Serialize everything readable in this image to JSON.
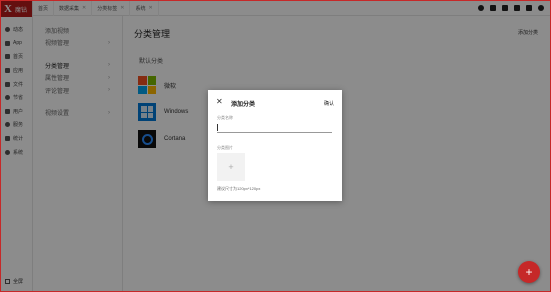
{
  "app": {
    "logo_letter": "X",
    "logo_text": "魔钻"
  },
  "sidebar": {
    "items": [
      {
        "label": "动态",
        "icon": "activity-icon"
      },
      {
        "label": "App",
        "icon": "phone-icon"
      },
      {
        "label": "首页",
        "icon": "folder-icon"
      },
      {
        "label": "应用",
        "icon": "apps-icon"
      },
      {
        "label": "文件",
        "icon": "file-icon"
      },
      {
        "label": "节省",
        "icon": "save-icon"
      },
      {
        "label": "用户",
        "icon": "user-icon"
      },
      {
        "label": "服务",
        "icon": "heart-icon"
      },
      {
        "label": "统计",
        "icon": "chart-icon"
      },
      {
        "label": "系统",
        "icon": "settings-icon"
      }
    ],
    "fullscreen_label": "全屏"
  },
  "tabs": [
    {
      "label": "首页",
      "closable": false
    },
    {
      "label": "数据采集",
      "closable": true
    },
    {
      "label": "分类标签",
      "closable": true
    },
    {
      "label": "系统",
      "closable": true
    }
  ],
  "menu": {
    "group1": [
      {
        "label": "添加视频"
      },
      {
        "label": "视频管理"
      }
    ],
    "group2": [
      {
        "label": "分类管理"
      },
      {
        "label": "属性管理"
      },
      {
        "label": "评论管理"
      }
    ],
    "group3": [
      {
        "label": "视频设置"
      }
    ]
  },
  "main": {
    "title": "分类管理",
    "add_link": "添加分类",
    "section_label": "默认分类",
    "categories": [
      {
        "name": "微软",
        "icon": "microsoft-logo-icon"
      },
      {
        "name": "Windows",
        "icon": "windows-logo-icon"
      },
      {
        "name": "Cortana",
        "icon": "cortana-logo-icon"
      }
    ]
  },
  "dialog": {
    "title": "添加分类",
    "confirm": "确认",
    "name_label": "分类名称",
    "name_value": "",
    "image_label": "分类图片",
    "upload_symbol": "+",
    "hint": "建议尺寸为120px*120px"
  },
  "fab": {
    "symbol": "+"
  },
  "colors": {
    "brand": "#b71c1c",
    "fab": "#c62828"
  }
}
